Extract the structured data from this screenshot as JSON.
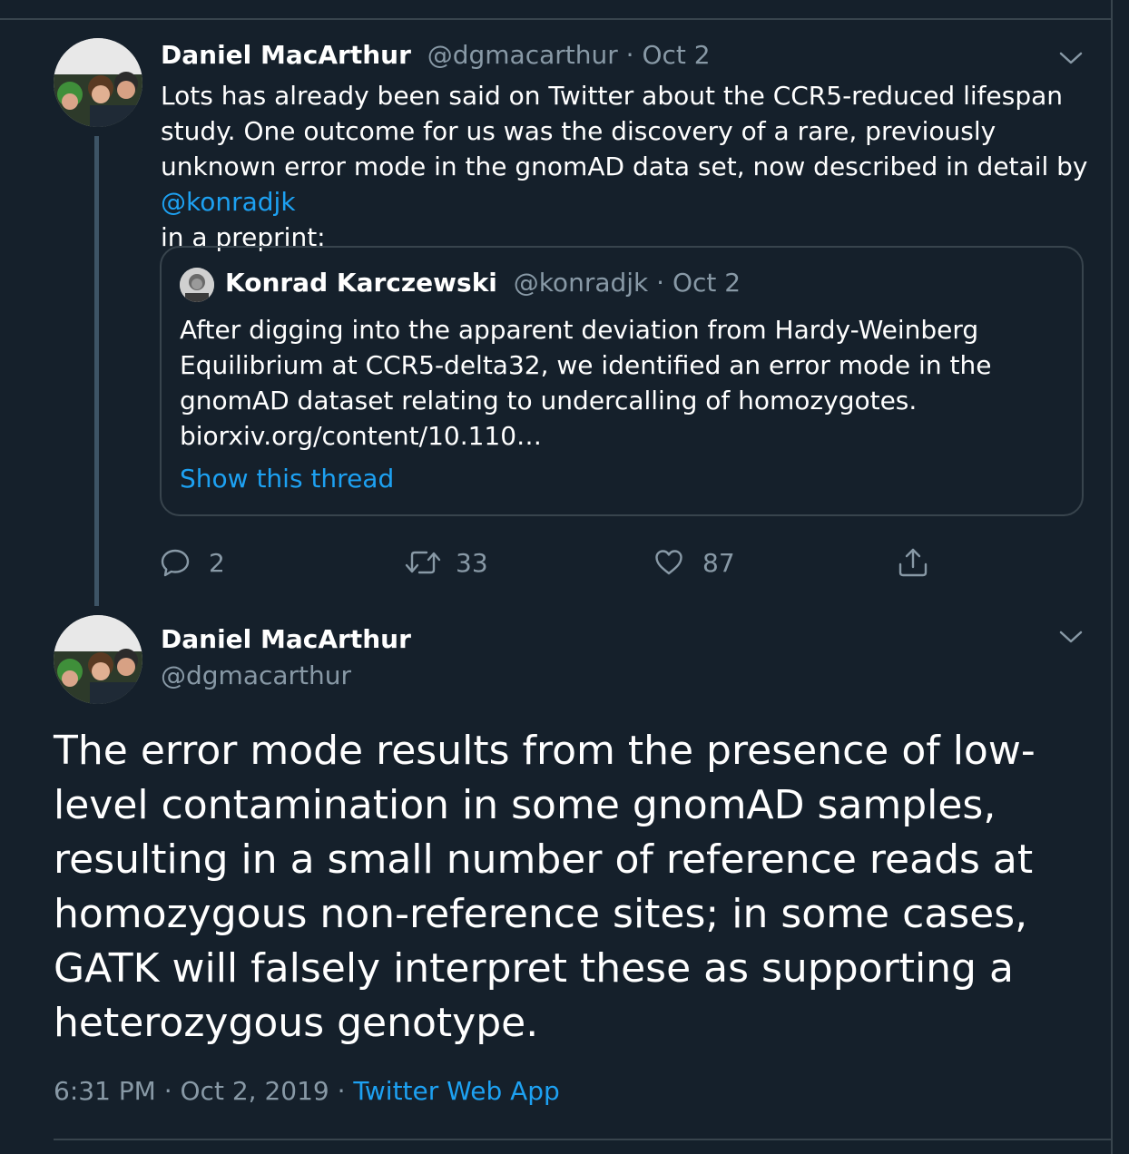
{
  "tweet1": {
    "author_name": "Daniel MacArthur",
    "author_handle": "@dgmacarthur",
    "separator": " · ",
    "date": "Oct 2",
    "text_before_mention": "Lots has already been said on Twitter about the CCR5-reduced lifespan study. One outcome for us was the discovery of a rare, previously unknown error mode in the gnomAD data set, now described in detail by ",
    "mention": "@konradjk",
    "text_after_mention": " in a preprint:",
    "quoted": {
      "author_name": "Konrad Karczewski",
      "author_handle": "@konradjk",
      "separator": " · ",
      "date": "Oct 2",
      "text": "After digging into the apparent deviation from Hardy-Weinberg Equilibrium at CCR5-delta32, we identified an error mode in the gnomAD dataset relating to undercalling of homozygotes. biorxiv.org/content/10.110…",
      "show_thread": "Show this thread"
    },
    "actions": {
      "replies": "2",
      "retweets": "33",
      "likes": "87"
    }
  },
  "tweet2": {
    "author_name": "Daniel MacArthur",
    "author_handle": "@dgmacarthur",
    "text": "The error mode results from the presence of low-level contamination in some gnomAD samples, resulting in a small number of reference reads at homozygous non-reference sites; in some cases, GATK will falsely interpret these as supporting a heterozygous genotype.",
    "time_date": "6:31 PM · Oct 2, 2019",
    "meta_separator": " · ",
    "source": "Twitter Web App"
  },
  "icons": {
    "more": "chevron-down-icon",
    "reply": "reply-icon",
    "retweet": "retweet-icon",
    "like": "heart-icon",
    "share": "share-icon"
  },
  "colors": {
    "background": "#15202b",
    "text": "#ffffff",
    "muted": "#8899a6",
    "link": "#1da1f2",
    "border": "#38444d"
  }
}
